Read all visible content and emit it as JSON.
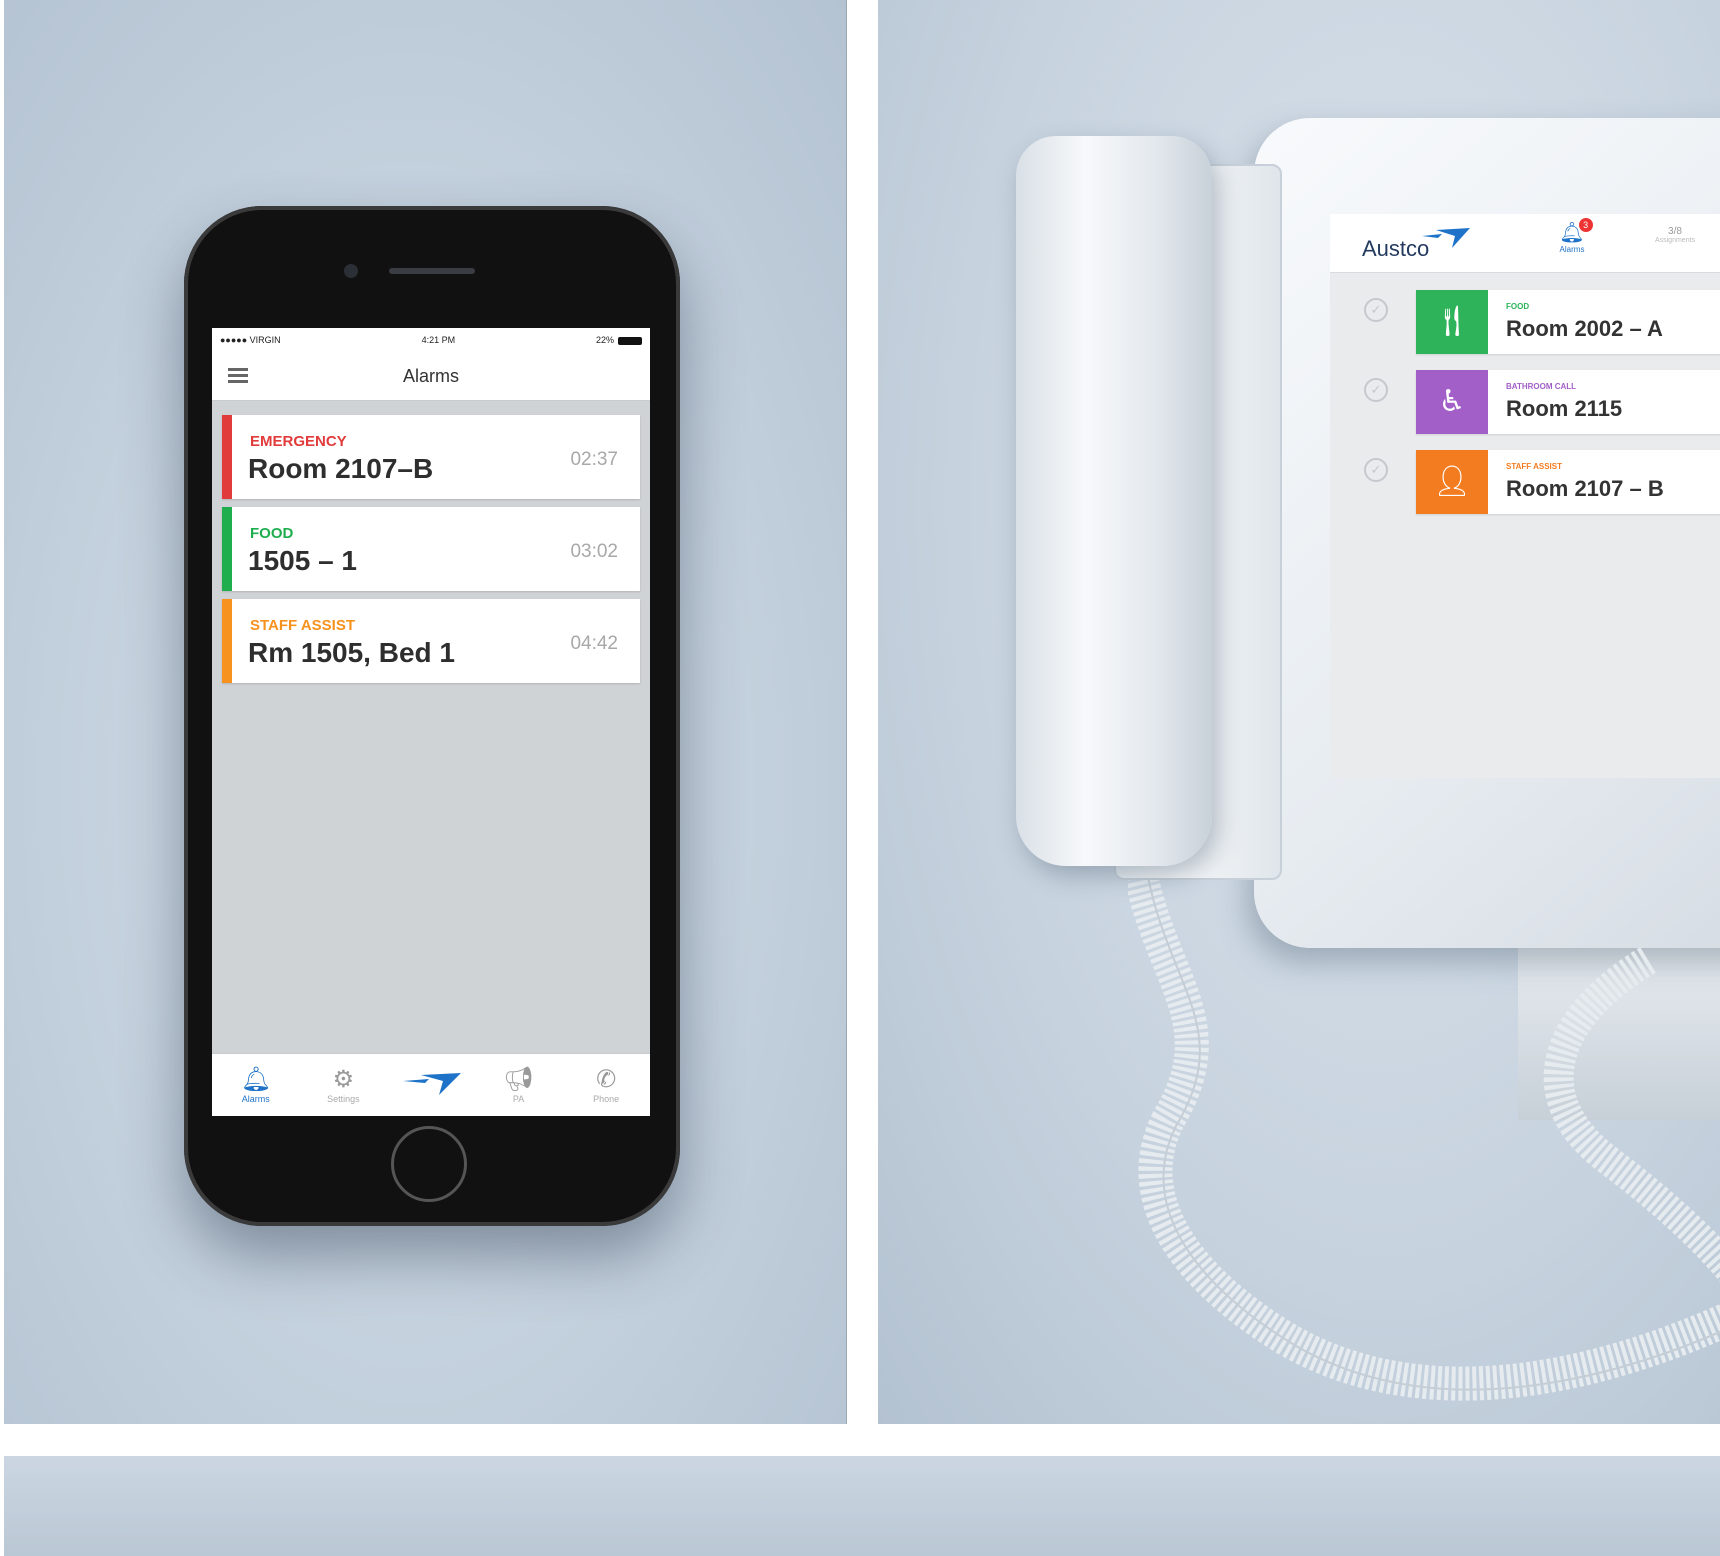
{
  "phone": {
    "status": {
      "carrier": "●●●●● VIRGIN",
      "time": "4:21 PM",
      "battery": "22%"
    },
    "title": "Alarms",
    "alarms": [
      {
        "type": "EMERGENCY",
        "room": "Room 2107–B",
        "time": "02:37",
        "color": "#e23b3b"
      },
      {
        "type": "FOOD",
        "room": "1505 – 1",
        "time": "03:02",
        "color": "#1fae4e"
      },
      {
        "type": "STAFF ASSIST",
        "room": "Rm 1505, Bed 1",
        "time": "04:42",
        "color": "#f7921e"
      }
    ],
    "tabs": [
      {
        "label": "Alarms",
        "icon": "bell-icon"
      },
      {
        "label": "Settings",
        "icon": "gear-icon"
      },
      {
        "label": "",
        "icon": "austco-logo-icon"
      },
      {
        "label": "PA",
        "icon": "megaphone-icon"
      },
      {
        "label": "Phone",
        "icon": "phone-icon"
      }
    ]
  },
  "device": {
    "brand": "Austco",
    "alarms_tab": {
      "label": "Alarms",
      "badge": "3"
    },
    "tab2": {
      "top": "3/8",
      "label": "Assignments"
    },
    "alarms": [
      {
        "type": "FOOD",
        "room": "Room 2002 – A",
        "color": "#2eb35a",
        "icon": "fork-knife-icon"
      },
      {
        "type": "BATHROOM CALL",
        "room": "Room 2115",
        "color": "#a25fc7",
        "icon": "wheelchair-icon"
      },
      {
        "type": "STAFF ASSIST",
        "room": "Room 2107 – B",
        "color": "#f47c20",
        "icon": "person-add-icon"
      }
    ]
  },
  "colors": {
    "accent": "#1e73c8",
    "background": "#c6d2de"
  }
}
